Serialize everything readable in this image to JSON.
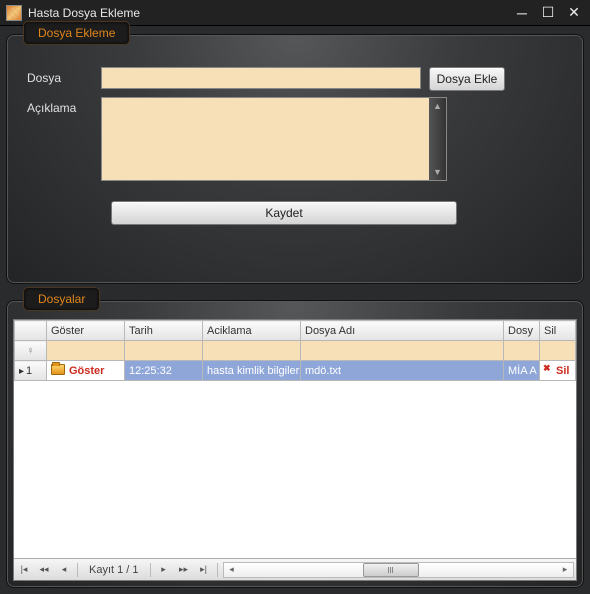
{
  "window": {
    "title": "Hasta Dosya Ekleme"
  },
  "panels": {
    "form_title": "Dosya Ekleme",
    "list_title": "Dosyalar"
  },
  "form": {
    "file_label": "Dosya",
    "file_value": "",
    "desc_label": "Açıklama",
    "desc_value": "",
    "attach_btn": "Dosya Ekle",
    "save_btn": "Kaydet"
  },
  "grid": {
    "headers": {
      "show": "Göster",
      "date": "Tarih",
      "desc": "Aciklama",
      "name": "Dosya Adı",
      "by": "Dosy",
      "del": "Sil"
    },
    "rows": [
      {
        "index": "1",
        "show_label": "Göster",
        "date": "12:25:32",
        "desc": "hasta kimlik bilgileri",
        "name": "mdö.txt",
        "by": "MİA A",
        "del_label": "Sil"
      }
    ]
  },
  "navigator": {
    "record_label": "Kayıt 1 / 1"
  }
}
